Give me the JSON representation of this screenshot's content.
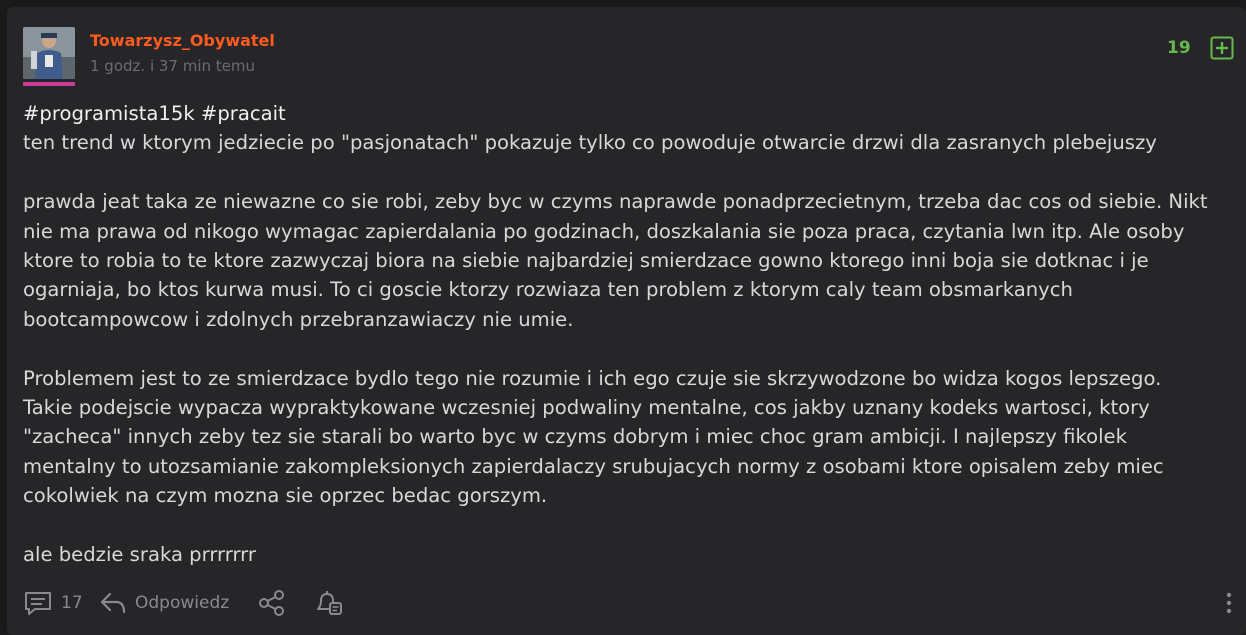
{
  "post": {
    "author": "Towarzysz_Obywatel",
    "timestamp": "1 godz. i 37 min temu",
    "votes": "19",
    "tags_line": "#programista15k #pracait",
    "paragraphs": [
      "ten trend w ktorym jedziecie po \"pasjonatach\" pokazuje tylko co powoduje otwarcie drzwi dla zasranych plebejuszy",
      "prawda jeat taka ze niewazne co sie robi, zeby byc w czyms naprawde ponadprzecietnym, trzeba dac cos od siebie. Nikt\nnie ma prawa od nikogo wymagac zapierdalania po godzinach, doszkalania sie poza praca, czytania lwn itp. Ale osoby\nktore to robia to te ktore zazwyczaj biora na siebie najbardziej smierdzace gowno ktorego inni boja sie dotknac i je\nogarniaja, bo ktos kurwa musi. To ci goscie ktorzy rozwiaza ten problem z ktorym caly team obsmarkanych\nbootcampowcow i zdolnych przebranzawiaczy nie umie.",
      "Problemem jest to ze smierdzace bydlo tego nie rozumie i ich ego czuje sie skrzywodzone bo widza kogos lepszego.\nTakie podejscie wypacza wypraktykowane wczesniej podwaliny mentalne, cos jakby uznany kodeks wartosci, ktory\n\"zacheca\" innych zeby tez sie starali bo warto byc w czyms dobrym i miec choc gram ambicji. I najlepszy fikolek\nmentalny to utozsamianie zakompleksionych zapierdalaczy srubujacych normy z osobami ktore opisalem zeby miec\ncokolwiek na czym mozna sie oprzec bedac gorszym.",
      "ale bedzie sraka prrrrrrr"
    ]
  },
  "footer": {
    "comments_count": "17",
    "reply_label": "Odpowiedz"
  },
  "icons": {
    "plus": "plus-square-icon",
    "comments": "comments-icon",
    "reply": "reply-arrow-icon",
    "share": "share-icon",
    "notify": "bell-icon",
    "more": "more-vertical-icon"
  },
  "colors": {
    "background": "#1a1a1b",
    "card": "#262628",
    "author": "#ff5a1f",
    "votes": "#67b84a",
    "text": "#d8d8d8",
    "muted": "#8a8a8e",
    "avatar_bar": "#c83d96"
  }
}
